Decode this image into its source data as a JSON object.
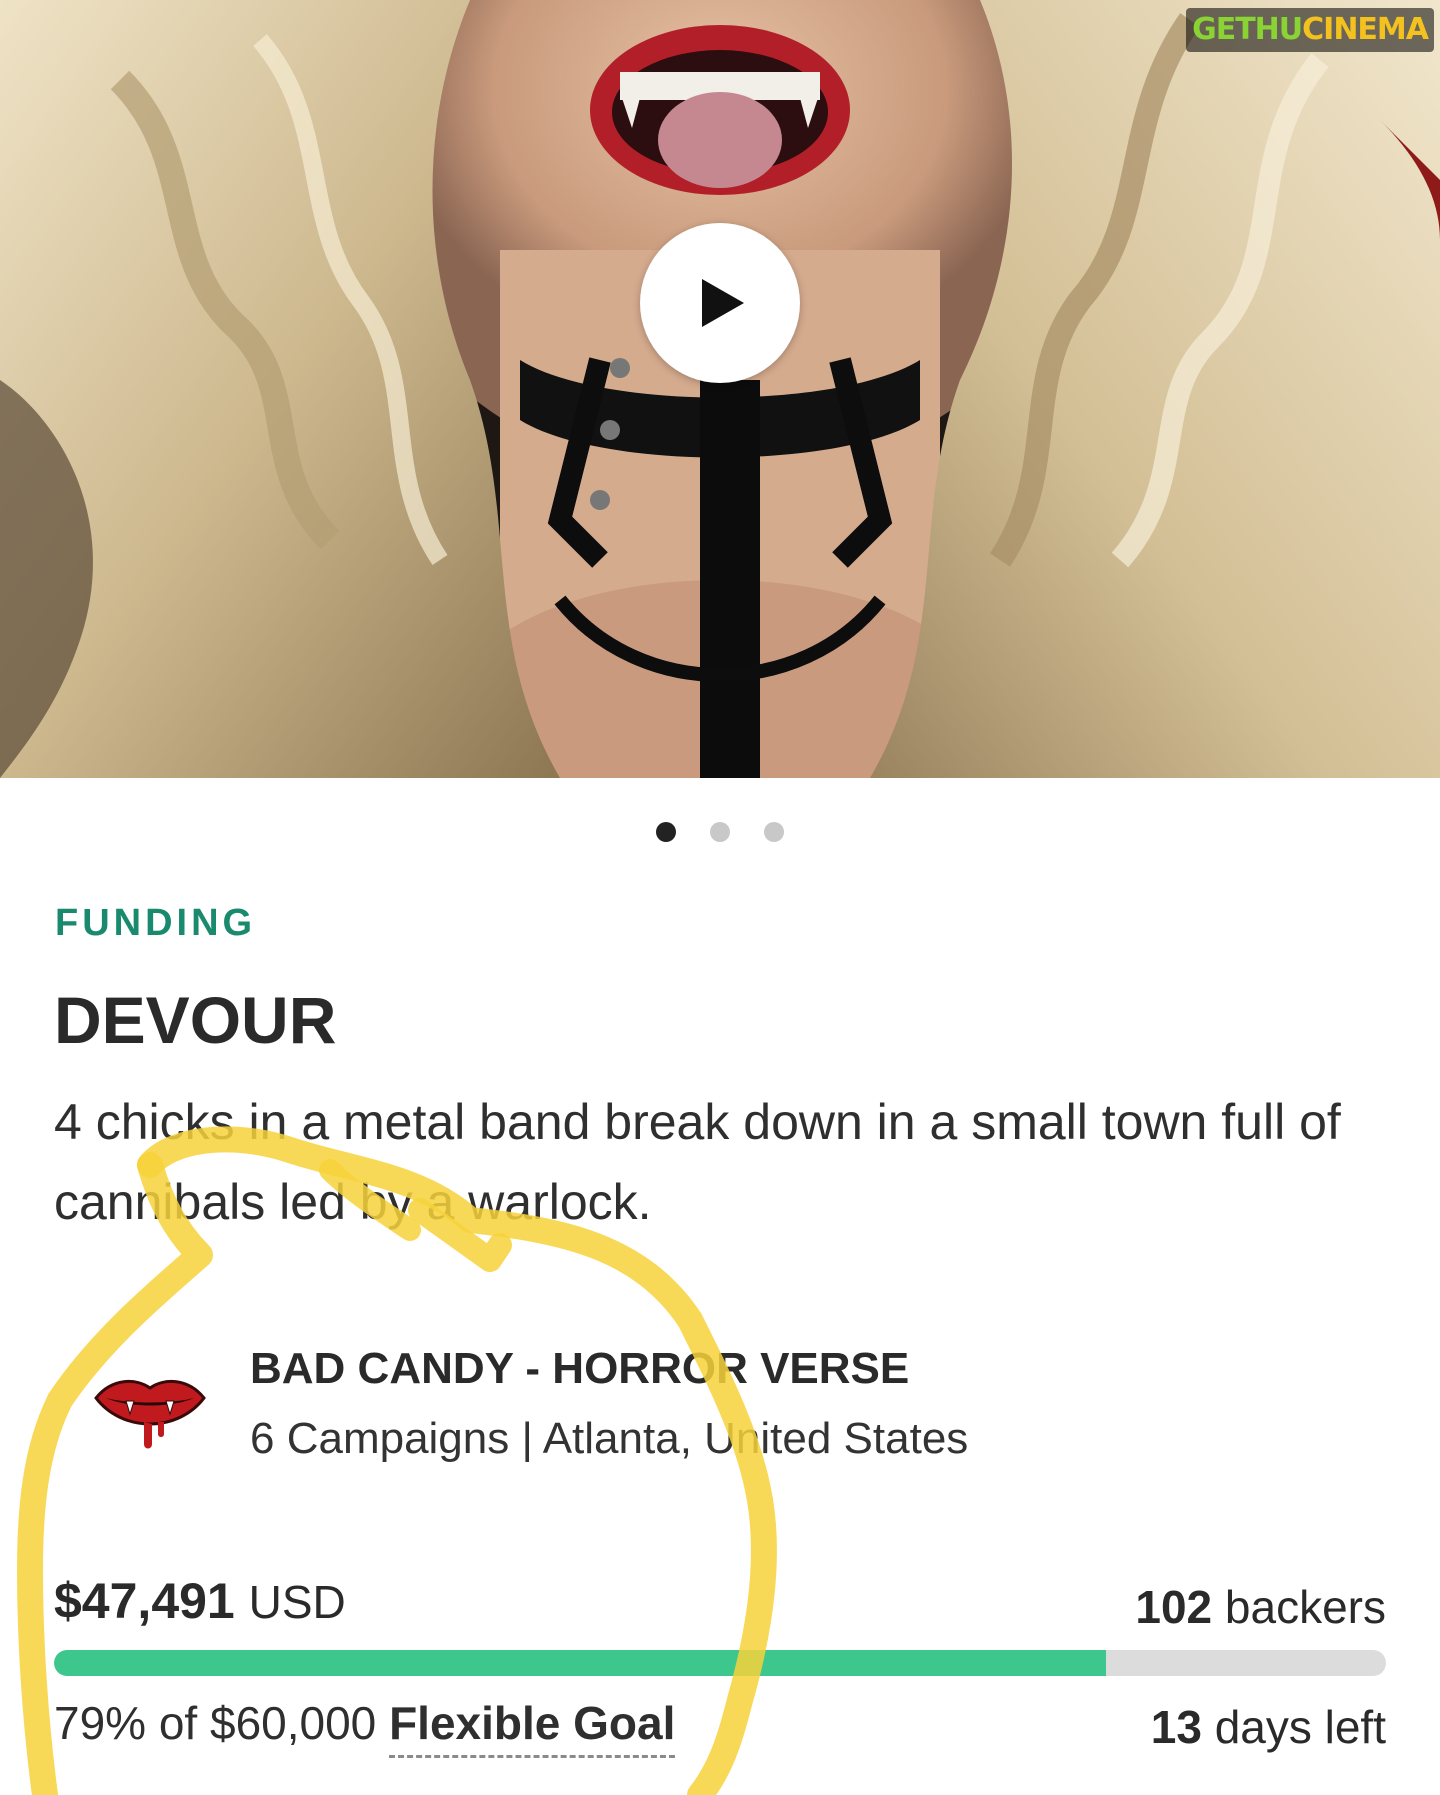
{
  "watermark": {
    "part1": "GETHU",
    "part2": "CINEMA"
  },
  "media": {
    "play_icon": "play-icon",
    "slides_total": 3,
    "active_slide": 1
  },
  "campaign": {
    "eyebrow": "FUNDING",
    "title": "DEVOUR",
    "tagline": "4 chicks in a metal band break down in a small town full of cannibals led by a warlock."
  },
  "creator": {
    "logo_icon": "vampire-lips-icon",
    "name": "BAD CANDY - HORROR VERSE",
    "meta": "6 Campaigns | Atlanta, United States"
  },
  "funding": {
    "amount": "$47,491",
    "currency": "USD",
    "backers_count": "102",
    "backers_label": "backers",
    "percent_text": "79% of $60,000",
    "percent_value": 79,
    "goal_type": "Flexible Goal",
    "days_count": "13",
    "days_label": "days left"
  },
  "colors": {
    "eyebrow": "#1a8a6f",
    "progress_fill": "#3ec78c",
    "progress_track": "#dcdcdc",
    "highlight": "#f7d23a"
  }
}
